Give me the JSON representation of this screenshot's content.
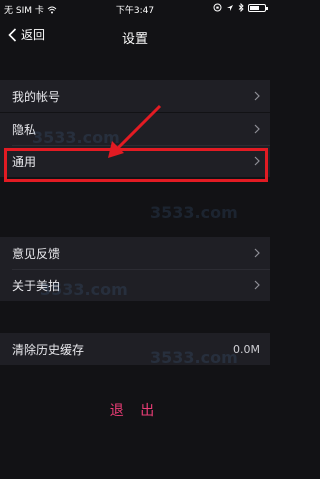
{
  "status_bar": {
    "carrier": "无 SIM 卡",
    "time": "下午3:47"
  },
  "nav": {
    "back_label": "返回",
    "title": "设置"
  },
  "groups": [
    {
      "items": [
        {
          "label": "我的帐号"
        }
      ]
    },
    {
      "items": [
        {
          "label": "隐私"
        },
        {
          "label": "通用"
        }
      ]
    },
    {
      "items": [
        {
          "label": "意见反馈"
        },
        {
          "label": "关于美拍"
        }
      ]
    },
    {
      "items": [
        {
          "label": "清除历史缓存",
          "value": "0.0M"
        }
      ]
    }
  ],
  "logout_label": "退 出",
  "watermark": "3533.com",
  "colors": {
    "background": "#121215",
    "cell": "#1f1f25",
    "highlight": "#e21b23",
    "logout": "#ea3d76"
  }
}
